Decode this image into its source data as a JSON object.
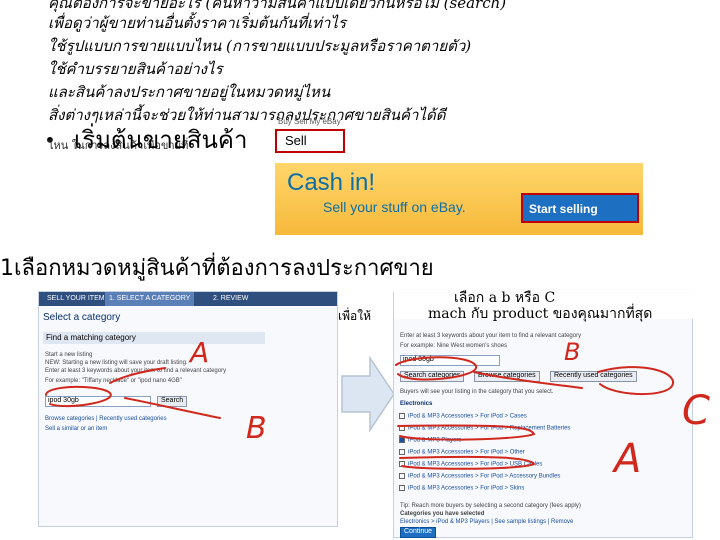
{
  "intro_lines": [
    "คุณต้องการจะขายอะไร (ค้นหาว่ามีสินค้าแบบเดียวกันหรือไม่ (search)",
    "เพื่อดูว่าผู้ขายท่านอื่นตั้งราคาเริ่มต้นกันที่เท่าไร",
    "ใช้รูปแบบการขายแบบไหน (การขายแบบประมูลหรือราคาตายตัว)",
    "ใช้คำบรรยายสินค้าอย่างไร",
    "และสินค้าลงประกาศขายอยู่ในหมวดหมู่ไหน",
    "สิ่งต่างๆเหล่านี้จะช่วยให้ท่านสามารถลงประกาศขายสินค้าได้ดี"
  ],
  "start": {
    "bullet": "•",
    "title": "เริ่มต้นขายสินค้า",
    "overlap_text": "ไหน ในการลงสินค้าเพื่อขายที่",
    "small_caption": "Buy Sell My eBay",
    "sell_label": "Sell"
  },
  "banner": {
    "headline": "Cash in!",
    "subline": "Sell your stuff on eBay.",
    "button_label": "Start selling"
  },
  "step1": {
    "heading": "1เลือกหมวดหมู่สินค้าที่ต้องการลงประกาศขาย"
  },
  "screen_left": {
    "tabs": [
      "SELL YOUR ITEM",
      "1. SELECT A CATEGORY",
      "2. REVIEW"
    ],
    "section_title": "Select a category",
    "find_bar": "Find a matching category",
    "hint1": "Start a new listing",
    "hint2": "NEW: Starting a new listing will save your draft listing.",
    "hint3": "Enter at least 3 keywords about your item to find a relevant category",
    "example": "For example: \"Tiffany necklace\" or \"ipod nano 4GB\"",
    "search_value": "ipod 30gb",
    "search_button": "Search",
    "browse_link": "Browse categories | Recently used categories",
    "sell_link": "Sell a similar or an item"
  },
  "screen_right": {
    "hint": "Enter at least 3 keywords about your item to find a relevant category",
    "example": "For example: Nine West women's shoes",
    "search_value": "ipod 30gb",
    "btn_a": "Search categories",
    "btn_b": "Browse categories",
    "btn_c": "Recently used categories",
    "buyers_note": "Buyers will see your listing in the category that you select.",
    "group": "Electronics",
    "categories": [
      "iPod & MP3 Accessories > For iPod > Cases",
      "iPod & MP3 Accessories > For iPod > Replacement Batteries",
      "iPod & MP3 Players",
      "iPod & MP3 Accessories > For iPod > Other",
      "iPod & MP3 Accessories > For iPod > USB Cables",
      "iPod & MP3 Accessories > For iPod > Accessory Bundles",
      "iPod & MP3 Accessories > For iPod > Skins"
    ],
    "checked_index": 2,
    "tip": "Tip: Reach more buyers by selecting a second category (fees apply)",
    "selected_label": "Categories you have selected",
    "selected_value": "Electronics > iPod & MP3 Players | See sample listings | Remove",
    "continue_label": "Continue"
  },
  "callout": {
    "line1": "เลือก  a b หรือ  C",
    "line2": "mach กับ  product ของคุณมากที่สุด",
    "line0": "เพื่อให้"
  },
  "annotations": [
    "A",
    "B",
    "C",
    "A",
    "B",
    "C"
  ],
  "colors": {
    "ink_red": "#d0281c",
    "ebay_blue": "#1d6fc2",
    "banner_yellow": "#f6b93b"
  }
}
